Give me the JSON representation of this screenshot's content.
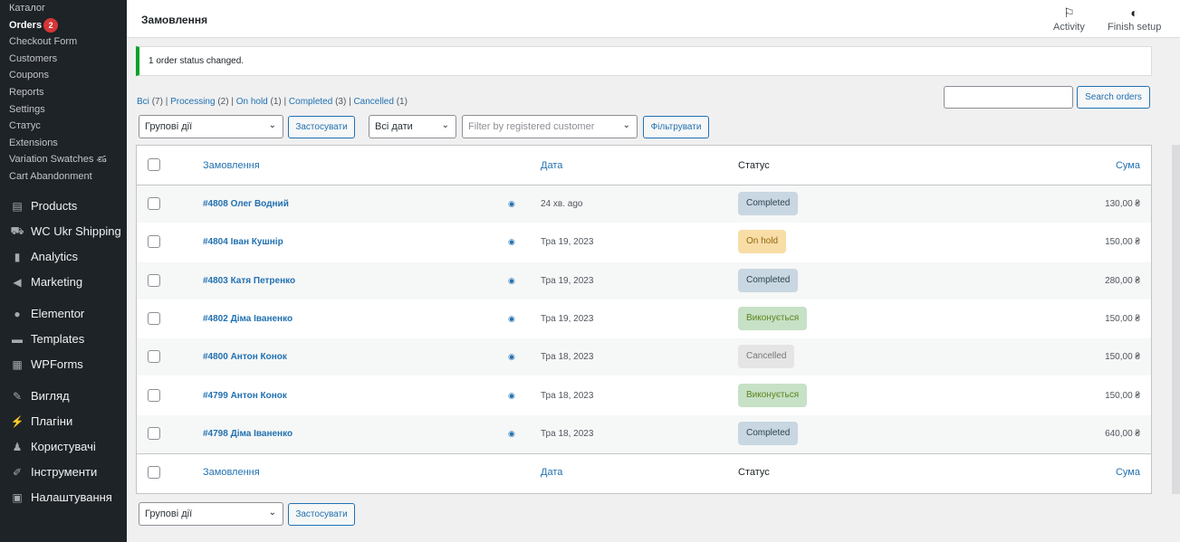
{
  "sidebar": {
    "sub_items": [
      {
        "label": "Каталог"
      },
      {
        "label": "Orders",
        "badge": "2",
        "active": true
      },
      {
        "label": "Checkout Form"
      },
      {
        "label": "Customers"
      },
      {
        "label": "Coupons"
      },
      {
        "label": "Reports"
      },
      {
        "label": "Settings"
      },
      {
        "label": "Статус"
      },
      {
        "label": "Extensions"
      },
      {
        "label": "Variation Swatches",
        "extra": "ණ"
      },
      {
        "label": "Cart Abandonment"
      }
    ],
    "main_items": [
      {
        "label": "Products",
        "icon": "archive-icon"
      },
      {
        "label": "WC Ukr Shipping",
        "icon": "truck-icon"
      },
      {
        "label": "Analytics",
        "icon": "bar-chart-icon"
      },
      {
        "label": "Marketing",
        "icon": "megaphone-icon"
      },
      {
        "label": "Elementor",
        "icon": "elementor-icon"
      },
      {
        "label": "Templates",
        "icon": "folder-icon"
      },
      {
        "label": "WPForms",
        "icon": "forms-icon"
      },
      {
        "label": "Вигляд",
        "icon": "brush-icon"
      },
      {
        "label": "Плагіни",
        "icon": "plugin-icon"
      },
      {
        "label": "Користувачі",
        "icon": "user-icon"
      },
      {
        "label": "Інструменти",
        "icon": "wrench-icon"
      },
      {
        "label": "Налаштування",
        "icon": "settings-icon"
      }
    ]
  },
  "header": {
    "title": "Замовлення",
    "activity_label": "Activity",
    "finish_setup_label": "Finish setup"
  },
  "notice": {
    "text": "1 order status changed."
  },
  "filters": {
    "all": "Всі",
    "all_count": "(7)",
    "processing": "Processing",
    "processing_count": "(2)",
    "on_hold": "On hold",
    "on_hold_count": "(1)",
    "completed": "Completed",
    "completed_count": "(3)",
    "cancelled": "Cancelled",
    "cancelled_count": "(1)",
    "separator": " | "
  },
  "search": {
    "button_label": "Search orders",
    "value": ""
  },
  "bulk": {
    "select_label": "Групові дії",
    "apply_label": "Застосувати",
    "dates_label": "Всі дати",
    "customer_placeholder": "Filter by registered customer",
    "filter_label": "Фільтрувати"
  },
  "table": {
    "columns": {
      "order": "Замовлення",
      "date": "Дата",
      "status": "Статус",
      "total": "Сума"
    },
    "rows": [
      {
        "order": "#4808 Олег Водний",
        "date": "24 хв. ago",
        "status": "Completed",
        "status_type": "completed",
        "total": "130,00 ₴"
      },
      {
        "order": "#4804 Іван Кушнір",
        "date": "Тра 19, 2023",
        "status": "On hold",
        "status_type": "on-hold",
        "total": "150,00 ₴"
      },
      {
        "order": "#4803 Катя Петренко",
        "date": "Тра 19, 2023",
        "status": "Completed",
        "status_type": "completed",
        "total": "280,00 ₴"
      },
      {
        "order": "#4802 Діма Іваненко",
        "date": "Тра 19, 2023",
        "status": "Виконується",
        "status_type": "processing",
        "total": "150,00 ₴"
      },
      {
        "order": "#4800 Антон Конок",
        "date": "Тра 18, 2023",
        "status": "Cancelled",
        "status_type": "cancelled",
        "total": "150,00 ₴"
      },
      {
        "order": "#4799 Антон Конок",
        "date": "Тра 18, 2023",
        "status": "Виконується",
        "status_type": "processing",
        "total": "150,00 ₴"
      },
      {
        "order": "#4798 Діма Іваненко",
        "date": "Тра 18, 2023",
        "status": "Completed",
        "status_type": "completed",
        "total": "640,00 ₴"
      }
    ]
  },
  "colors": {
    "completed_bg": "#c8d7e1",
    "completed_fg": "#2e4453",
    "on_hold_bg": "#f8dda7",
    "on_hold_fg": "#94660c",
    "processing_bg": "#c6e1c6",
    "processing_fg": "#5b841b",
    "cancelled_bg": "#e5e5e5",
    "cancelled_fg": "#777777"
  }
}
